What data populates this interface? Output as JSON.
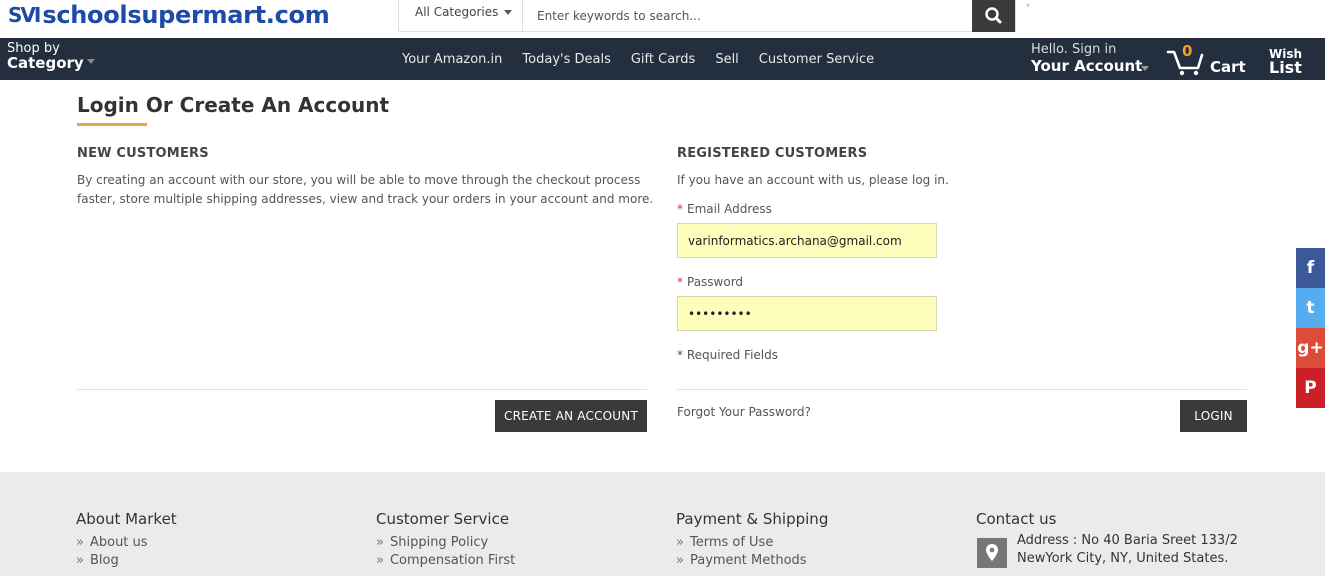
{
  "header": {
    "logo_mark": "SVI",
    "logo_text": "schoolsupermart.com",
    "category_select": "All Categories",
    "search_placeholder": "Enter keywords to search...",
    "dot": "°"
  },
  "nav": {
    "shop_line1": "Shop by",
    "shop_line2": "Category",
    "links": [
      "Your Amazon.in",
      "Today's Deals",
      "Gift Cards",
      "Sell",
      "Customer Service"
    ],
    "account_line1": "Hello. Sign in",
    "account_line2": "Your Account",
    "cart_count": "0",
    "cart_label": "Cart",
    "wish_line1": "Wish",
    "wish_line2": "List"
  },
  "main": {
    "title": "Login Or Create An Account",
    "new_customers": {
      "heading": "NEW CUSTOMERS",
      "text": "By creating an account with our store, you will be able to move through the checkout process faster, store multiple shipping addresses, view and track your orders in your account and more.",
      "button": "CREATE AN ACCOUNT"
    },
    "registered": {
      "heading": "REGISTERED CUSTOMERS",
      "intro": "If you have an account with us, please log in.",
      "required_mark": "*",
      "email_label": "Email Address",
      "email_value": "varinformatics.archana@gmail.com",
      "password_label": "Password",
      "password_value": "•••••••••",
      "required_note": "* Required Fields",
      "forgot": "Forgot Your Password?",
      "login_button": "LOGIN"
    }
  },
  "footer": {
    "about": {
      "title": "About Market",
      "items": [
        "About us",
        "Blog"
      ]
    },
    "service": {
      "title": "Customer Service",
      "items": [
        "Shipping Policy",
        "Compensation First"
      ]
    },
    "payment": {
      "title": "Payment & Shipping",
      "items": [
        "Terms of Use",
        "Payment Methods"
      ]
    },
    "contact": {
      "title": "Contact us",
      "address_line1": "Address : No 40 Baria Sreet 133/2",
      "address_line2": "NewYork City, NY, United States."
    },
    "chevron": "»"
  },
  "social": {
    "facebook": "f",
    "twitter": "t",
    "googleplus": "g+",
    "pinterest": "P"
  },
  "colors": {
    "nav_bg": "#232f3e",
    "accent": "#e8a440",
    "field_bg": "#fefebc",
    "button_bg": "#3a3a3a"
  }
}
